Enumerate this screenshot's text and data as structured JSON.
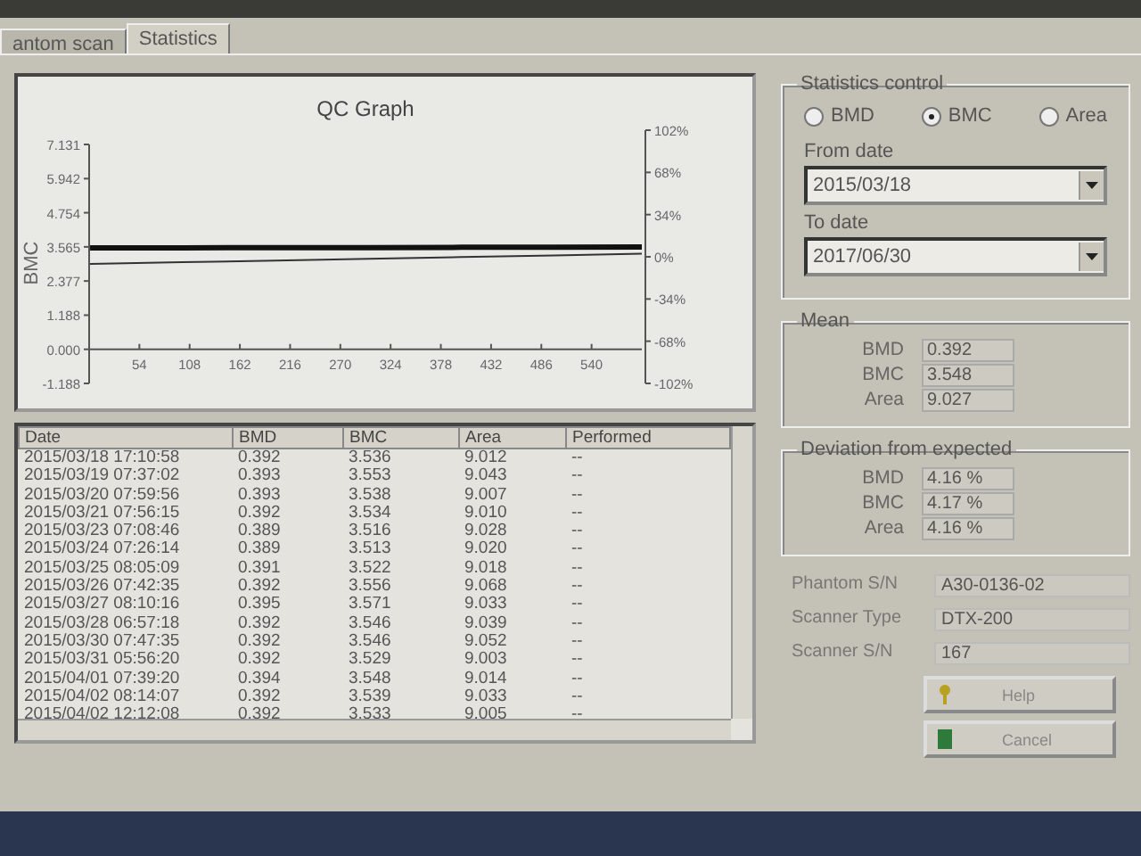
{
  "tabs": [
    {
      "label": "antom scan",
      "selected": false
    },
    {
      "label": "Statistics",
      "selected": true
    }
  ],
  "graph": {
    "chart_data": {
      "type": "line",
      "title": "QC Graph",
      "ylabel": "BMC",
      "x": [
        1,
        100,
        200,
        300,
        400,
        500,
        594
      ],
      "series": [
        {
          "color": "#111111",
          "values": [
            3.53,
            3.53,
            3.54,
            3.54,
            3.55,
            3.55,
            3.56
          ]
        },
        {
          "color": "#333333",
          "values": [
            2.97,
            3.03,
            3.09,
            3.15,
            3.21,
            3.27,
            3.33
          ]
        }
      ],
      "xlim": [
        0,
        594
      ],
      "ylim": [
        -1.188,
        7.131
      ],
      "xticks": [
        54,
        108,
        162,
        216,
        270,
        324,
        378,
        432,
        486,
        540
      ],
      "yticks": [
        {
          "value": 7.131,
          "label": "7.131"
        },
        {
          "value": 5.942,
          "label": "5.942"
        },
        {
          "value": 4.754,
          "label": "4.754"
        },
        {
          "value": 3.565,
          "label": "3.565"
        },
        {
          "value": 2.377,
          "label": "2.377"
        },
        {
          "value": 1.188,
          "label": "1.188"
        },
        {
          "value": 0,
          "label": "0.000"
        },
        {
          "value": -1.188,
          "label": "-1.188"
        }
      ]
    },
    "right_axis": {
      "ticks": [
        "102%",
        "68%",
        "34%",
        "0%",
        "-34%",
        "-68%",
        "-102%"
      ]
    }
  },
  "table": {
    "columns": [
      "Date",
      "BMD",
      "BMC",
      "Area",
      "Performed"
    ],
    "rows": [
      [
        "2015/03/18 17:10:58",
        "0.392",
        "3.536",
        "9.012",
        "--"
      ],
      [
        "2015/03/19 07:37:02",
        "0.393",
        "3.553",
        "9.043",
        "--"
      ],
      [
        "2015/03/20 07:59:56",
        "0.393",
        "3.538",
        "9.007",
        "--"
      ],
      [
        "2015/03/21 07:56:15",
        "0.392",
        "3.534",
        "9.010",
        "--"
      ],
      [
        "2015/03/23 07:08:46",
        "0.389",
        "3.516",
        "9.028",
        "--"
      ],
      [
        "2015/03/24 07:26:14",
        "0.389",
        "3.513",
        "9.020",
        "--"
      ],
      [
        "2015/03/25 08:05:09",
        "0.391",
        "3.522",
        "9.018",
        "--"
      ],
      [
        "2015/03/26 07:42:35",
        "0.392",
        "3.556",
        "9.068",
        "--"
      ],
      [
        "2015/03/27 08:10:16",
        "0.395",
        "3.571",
        "9.033",
        "--"
      ],
      [
        "2015/03/28 06:57:18",
        "0.392",
        "3.546",
        "9.039",
        "--"
      ],
      [
        "2015/03/30 07:47:35",
        "0.392",
        "3.546",
        "9.052",
        "--"
      ],
      [
        "2015/03/31 05:56:20",
        "0.392",
        "3.529",
        "9.003",
        "--"
      ],
      [
        "2015/04/01 07:39:20",
        "0.394",
        "3.548",
        "9.014",
        "--"
      ],
      [
        "2015/04/02 08:14:07",
        "0.392",
        "3.539",
        "9.033",
        "--"
      ],
      [
        "2015/04/02 12:12:08",
        "0.392",
        "3.533",
        "9.005",
        "--"
      ]
    ]
  },
  "statistics_control": {
    "title": "Statistics control",
    "options": [
      {
        "label": "BMD",
        "selected": false
      },
      {
        "label": "BMC",
        "selected": true
      },
      {
        "label": "Area",
        "selected": false
      }
    ],
    "from_date": {
      "label": "From date",
      "value": "2015/03/18"
    },
    "to_date": {
      "label": "To date",
      "value": "2017/06/30"
    }
  },
  "mean": {
    "title": "Mean",
    "rows": [
      {
        "label": "BMD",
        "value": "0.392"
      },
      {
        "label": "BMC",
        "value": "3.548"
      },
      {
        "label": "Area",
        "value": "9.027"
      }
    ]
  },
  "deviation": {
    "title": "Deviation from expected",
    "rows": [
      {
        "label": "BMD",
        "value": "4.16 %"
      },
      {
        "label": "BMC",
        "value": "4.17 %"
      },
      {
        "label": "Area",
        "value": "4.16 %"
      }
    ]
  },
  "info": [
    {
      "label": "Phantom S/N",
      "value": "A30-0136-02"
    },
    {
      "label": "Scanner Type",
      "value": "DTX-200"
    },
    {
      "label": "Scanner S/N",
      "value": "167"
    }
  ],
  "buttons": [
    {
      "kind": "help",
      "label": "Help"
    },
    {
      "kind": "cancel",
      "label": "Cancel"
    }
  ]
}
